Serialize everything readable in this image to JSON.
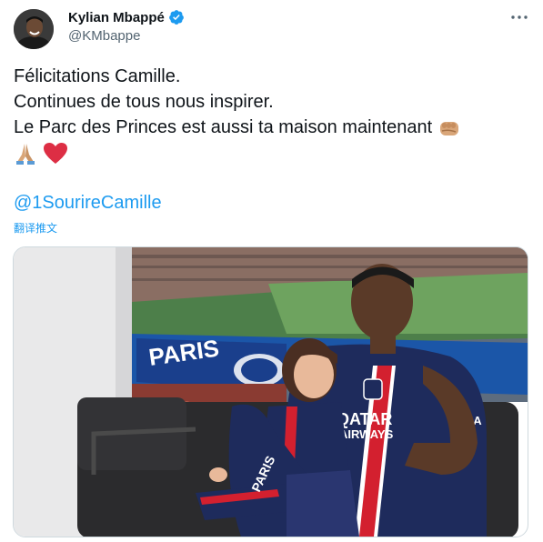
{
  "author": {
    "name": "Kylian Mbappé",
    "handle": "@KMbappe",
    "avatar_icon": "person-avatar",
    "verified_icon": "verified-badge-icon",
    "verified_color": "#1d9bf0"
  },
  "tweet": {
    "lines": [
      "Félicitations Camille.",
      "Continues de tous nous inspirer.",
      "Le Parc des Princes est aussi ta maison maintenant"
    ],
    "emojis": [
      "fist-emoji",
      "folded-hands-emoji",
      "red-heart-emoji"
    ],
    "mention": "@1SourireCamille",
    "translate_label": "翻译推文"
  },
  "media": {
    "stadium_banner": "PARIS",
    "jersey_sponsor_line1": "QATAR",
    "jersey_sponsor_line2": "AIRWAYS",
    "jersey_sleeve": "GOA",
    "shorts_text": "PARIS"
  },
  "colors": {
    "link": "#1d9bf0",
    "text": "#0f1419",
    "secondary": "#536471",
    "psg_navy": "#1e2b5c",
    "psg_red": "#d3202f"
  }
}
